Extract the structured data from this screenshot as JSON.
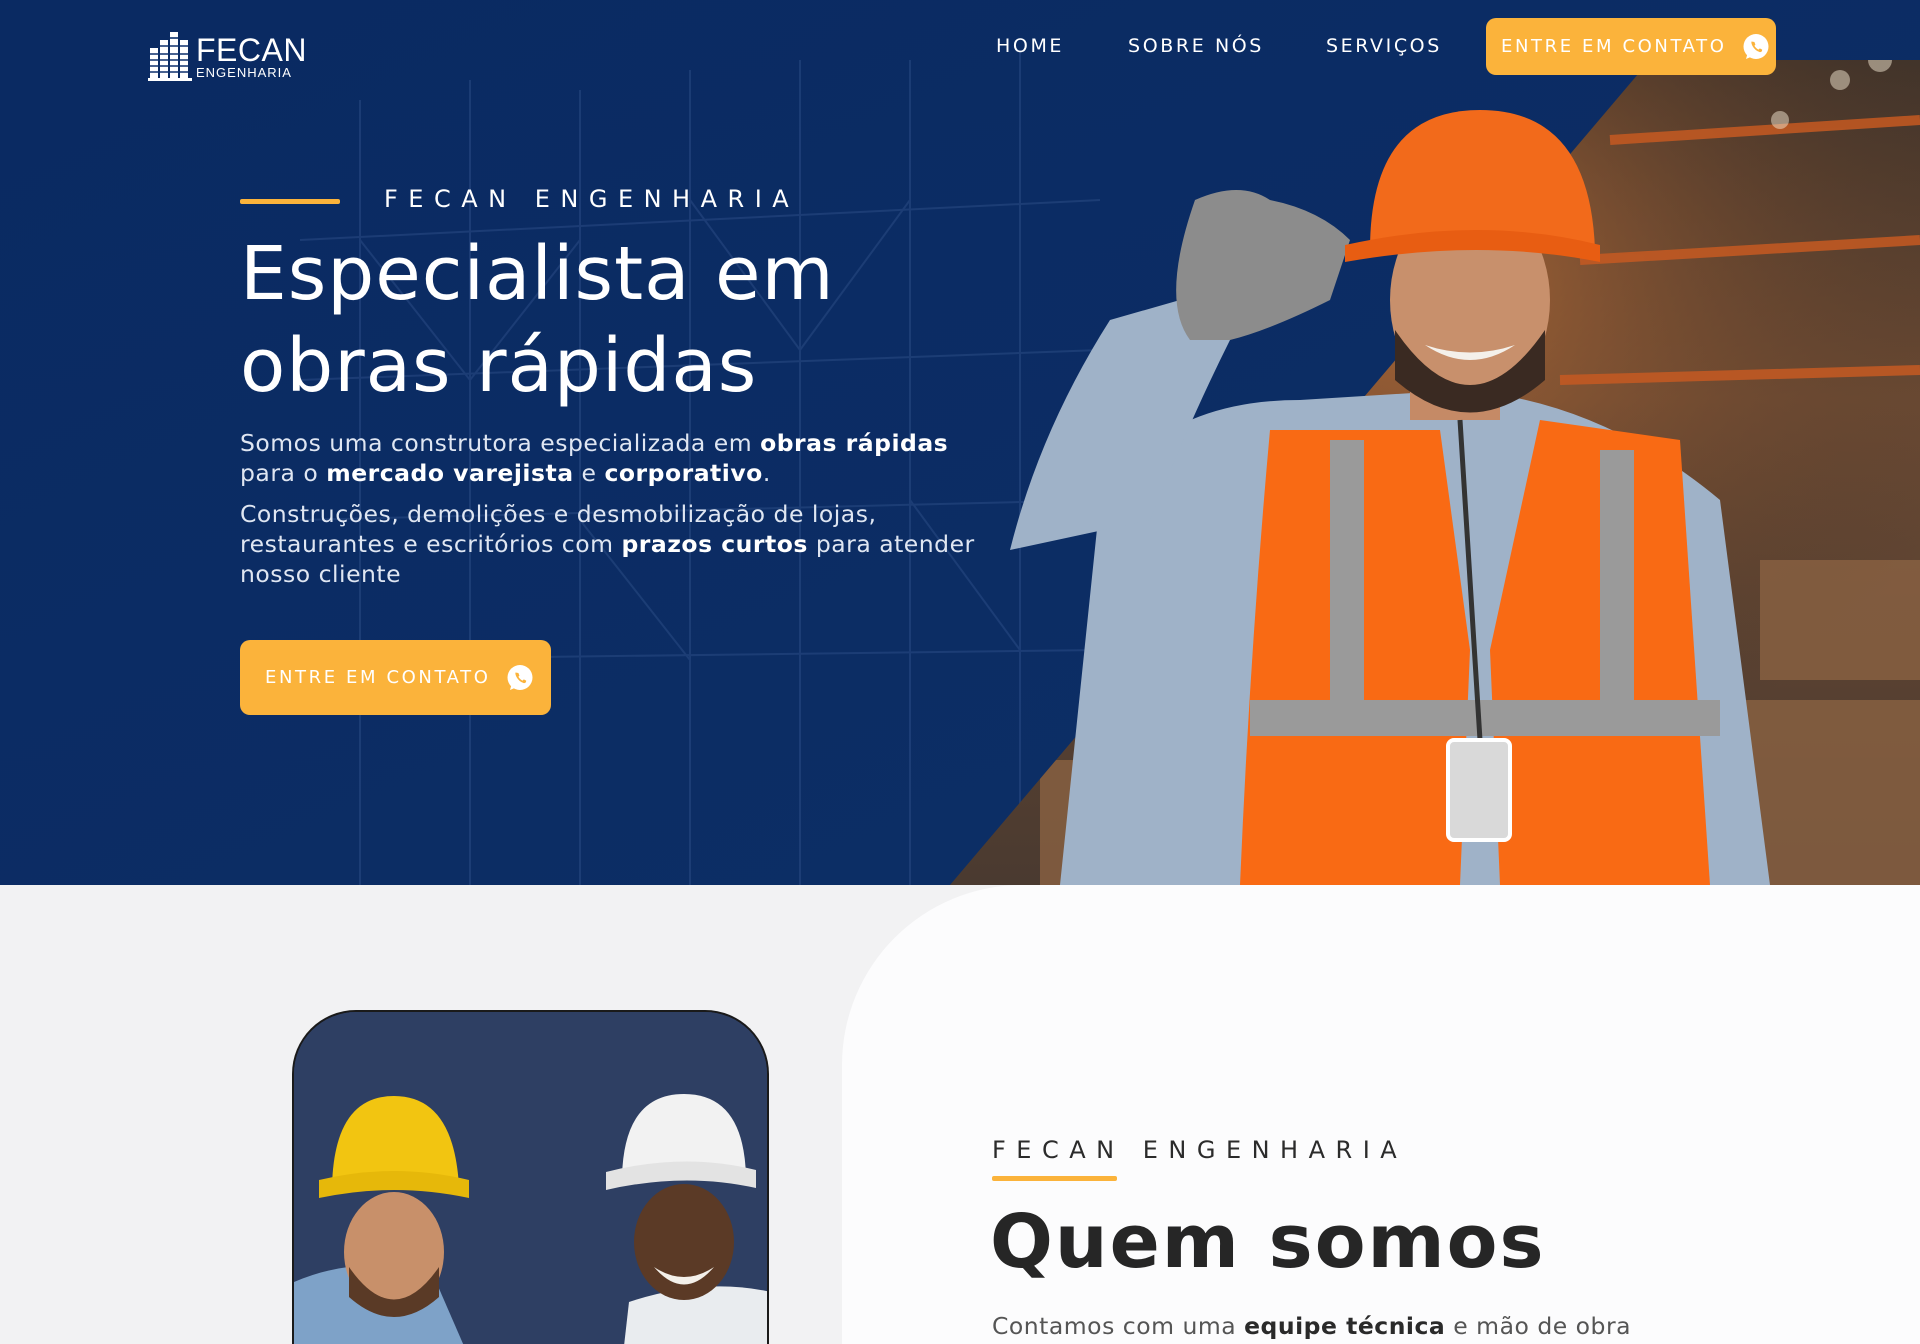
{
  "brand": {
    "name": "FECAN",
    "sub": "ENGENHARIA"
  },
  "nav": {
    "items": [
      "HOME",
      "SOBRE NÓS",
      "SERVIÇOS"
    ],
    "cta_label": "ENTRE EM CONTATO"
  },
  "hero": {
    "eyebrow": "FECAN ENGENHARIA",
    "title_line1": "Especialista em",
    "title_line2": "obras rápidas",
    "p1": {
      "t1": "Somos uma construtora especializada em ",
      "b1": "obras rápidas",
      "t2": " para o ",
      "b2": "mercado varejista",
      "t3": " e ",
      "b3": "corporativo",
      "t4": "."
    },
    "p2": {
      "t1": "Construções, demolições e desmobilização de lojas, restaurantes e escritórios com ",
      "b1": "prazos curtos",
      "t2": " para atender nosso cliente"
    },
    "cta_label": "ENTRE EM CONTATO"
  },
  "about": {
    "eyebrow": "FECAN ENGENHARIA",
    "title": "Quem somos",
    "p": {
      "t1": "Contamos com uma ",
      "b1": "equipe técnica",
      "t2": " e mão de obra"
    }
  },
  "colors": {
    "hero_blue": "#0b2f6b",
    "accent_yellow": "#fbb33b",
    "white": "#ffffff",
    "section_light": "#f2f2f3",
    "section_white": "#fcfcfd"
  },
  "icons": {
    "cta": "whatsapp-icon",
    "logo": "building-logo-icon"
  }
}
